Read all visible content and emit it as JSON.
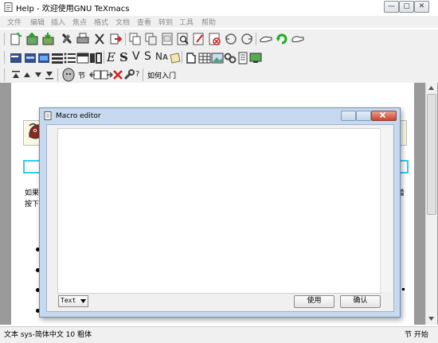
{
  "window": {
    "title": "Help - 欢迎使用GNU TeXmacs",
    "minimize_glyph": "—",
    "maximize_glyph": "▢",
    "close_glyph": "✕"
  },
  "menubar": {
    "items": [
      "文件",
      "编辑",
      "插入",
      "焦点",
      "格式",
      "文档",
      "查看",
      "转到",
      "工具",
      "帮助"
    ]
  },
  "toolbar1": {
    "icons": [
      "new-document-icon",
      "open-folder-icon",
      "save-icon",
      "tools-icon",
      "print-icon",
      "cut-icon",
      "export-icon",
      "copy-icon",
      "paste-icon",
      "replace-icon",
      "search-icon",
      "spell-icon",
      "cancel-search-icon",
      "undo-icon",
      "redo-icon",
      "hand-icon",
      "refresh-icon",
      "pointing-hand-icon"
    ]
  },
  "toolbar2": {
    "icons": [
      "align-left-icon",
      "align-center-icon",
      "picture-icon",
      "stack-icon",
      "list-icon",
      "table-icon",
      "theorem-icon"
    ],
    "format_glyphs": {
      "e": "E",
      "s": "S",
      "v": "V",
      "s2": "S",
      "na": "Nᴀ"
    },
    "icons_after": [
      "scroll-icon",
      "puzzle-icon",
      "grid-icon",
      "image-icon",
      "link-icon",
      "document-icon",
      "monitor-icon"
    ]
  },
  "toolbar3": {
    "section_label": "节",
    "help_label": "?",
    "nav_label": "如何入门"
  },
  "document": {
    "para_line1": "如果",
    "para_line1_end": "着",
    "para_line2": "按下"
  },
  "dialog": {
    "title": "Macro editor",
    "mode_value": "Text",
    "apply_label": "使用",
    "ok_label": "确认"
  },
  "statusbar": {
    "left": "文本 sys-简体中文 10 粗体",
    "right": "节 开始"
  },
  "colors": {
    "accent": "#6d8fb4",
    "menu_text": "#8c8c8c",
    "dialog_frame": "#c6d9ee"
  }
}
